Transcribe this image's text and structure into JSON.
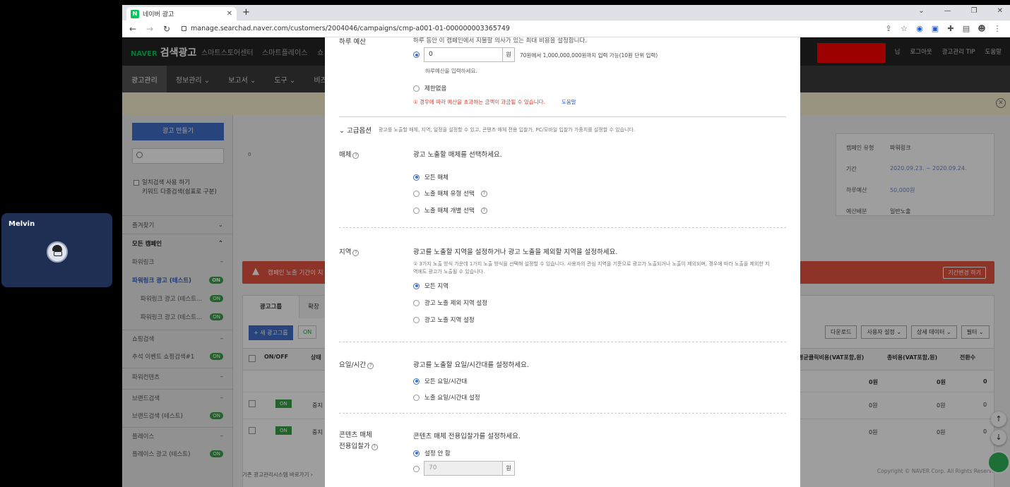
{
  "video_call": {
    "name": "Melvin"
  },
  "browser": {
    "tab_title": "네이버 광고",
    "favicon_letter": "N",
    "url": "manage.searchad.naver.com/customers/2004046/campaigns/cmp-a001-01-000000003365749"
  },
  "header": {
    "naver": "NAVER",
    "title": "검색광고",
    "services": [
      "스마트스토어센터",
      "스마트플레이스",
      "쇼"
    ],
    "right_links": [
      "님",
      "로그아웃",
      "광고관리 TIP",
      "도움말"
    ]
  },
  "menu": [
    "광고관리",
    "정보관리 ⌄",
    "보고서 ⌄",
    "도구 ⌄",
    "비즈머"
  ],
  "sidebar": {
    "create_button": "광고 만들기",
    "checkbox_line1": "일치검색 사용 하기",
    "checkbox_line2": "키워드 다중검색(쉼표로 구분)",
    "favorites": "즐겨찾기",
    "all_campaigns": "모든 캠페인",
    "items": [
      {
        "label": "파워링크",
        "suffix": "–"
      },
      {
        "label": "파워링크 광고 (테스트)",
        "suffix": "ON"
      },
      {
        "label": "파워링크 광고 (테스트...",
        "suffix": "ON"
      },
      {
        "label": "파워링크 광고 (테스트...",
        "suffix": "ON"
      },
      {
        "label": "쇼핑검색",
        "suffix": "–"
      },
      {
        "label": "추석 이벤트 쇼핑검색#1",
        "suffix": "ON"
      },
      {
        "label": "파워컨텐츠",
        "suffix": "–"
      },
      {
        "label": "브랜드검색",
        "suffix": "–"
      },
      {
        "label": "브랜드검색 (테스트)",
        "suffix": "ON"
      },
      {
        "label": "플레이스",
        "suffix": "–"
      },
      {
        "label": "플레이스 광고 (테스트)",
        "suffix": "ON"
      }
    ],
    "bottom_text": "기존 광고관리시스템 바로가기 ›"
  },
  "campaign_info": {
    "rows": [
      {
        "label": "캠페인 유형",
        "value": "파워링크"
      },
      {
        "label": "기간",
        "value": "2020.09.23. ~ 2020.09.24."
      },
      {
        "label": "하루예산",
        "value": "50,000원"
      },
      {
        "label": "예산배분",
        "value": "일반노출"
      }
    ]
  },
  "alert": {
    "text": "캠페인 노출 기간이 지",
    "button": "기간변경 하기"
  },
  "table": {
    "tabs": [
      "광고그룹",
      "확장"
    ],
    "new_group_button": "+ 새 광고그룹",
    "on_label": "ON",
    "right_buttons": [
      "다운로드",
      "사용자 설정 ⌄",
      "상세 데이터 ⌄",
      "필터 ⌄"
    ],
    "headers": {
      "onoff": "ON/OFF",
      "status": "상태",
      "avg_cost": "평균클릭비용(VAT포함,원)",
      "total_cost": "총비용(VAT포함,원)",
      "conversions": "전환수"
    },
    "total_row": {
      "avg_cost": "0원",
      "total_cost": "0원",
      "conversions": "0"
    },
    "rows": [
      {
        "onoff": "ON",
        "status": "중지",
        "avg_cost": "0원",
        "total_cost": "0원",
        "conversions": "0"
      },
      {
        "onoff": "ON",
        "status": "중지",
        "avg_cost": "0원",
        "total_cost": "0원",
        "conversions": "0"
      }
    ],
    "left_number": "0"
  },
  "footer": "Copyright © NAVER Corp. All Rights Reserved.",
  "modal": {
    "budget_partial_label": "하루 예산",
    "budget_top_text": "하루 동안 이 캠페인에서 지불할 의사가 있는 최대 비용을 설정합니다.",
    "budget_value": "0",
    "budget_unit": "원",
    "budget_hint": "70원에서 1,000,000,000원까지 입력 가능(10원 단위 입력)",
    "budget_sub": "하루예산을 입력하세요.",
    "unlimited": "제한없음",
    "warning": "① 경우에 따라 예산을 초과하는 금액이 과금될 수 있습니다.",
    "warning_link": "도움말",
    "advanced_label": "⌄ 고급옵션",
    "advanced_desc": "광고를 노출할 매체, 지역, 일정을 설정할 수 있고, 콘텐츠 매체 전용 입찰가, PC/모바일 입찰가 가중치를 설정할 수 있습니다.",
    "media": {
      "label": "매체",
      "desc": "광고 노출할 매체를 선택하세요.",
      "options": [
        "모든 매체",
        "노출 매체 유형 선택",
        "노출 매체 개별 선택"
      ]
    },
    "region": {
      "label": "지역",
      "desc": "광고를 노출할 지역을 설정하거나 광고 노출을 제외할 지역을 설정하세요.",
      "note": "① 3가지 노출 방식 가운데 1가지 노출 방식을 선택해 설정할 수 있습니다. 사용자의 관심 지역을 기준으로 광고가 노출되거나 노출이 제외되며, 경우에 따라 노출을 제외한 지역에도 광고가 노출될 수 있습니다.",
      "options": [
        "모든 지역",
        "광고 노출 제외 지역 설정",
        "광고 노출 지역 설정"
      ]
    },
    "schedule": {
      "label": "요일/시간",
      "desc": "광고를 노출할 요일/시간대를 설정하세요.",
      "options": [
        "모든 요일/시간대",
        "노출 요일/시간대 설정"
      ]
    },
    "content_bid": {
      "label_line1": "콘텐츠 매체",
      "label_line2": "전용입찰가",
      "desc": "콘텐츠 매체 전용입찰가를 설정하세요.",
      "options": [
        "설정 안 함"
      ],
      "value": "70",
      "unit": "원"
    }
  }
}
